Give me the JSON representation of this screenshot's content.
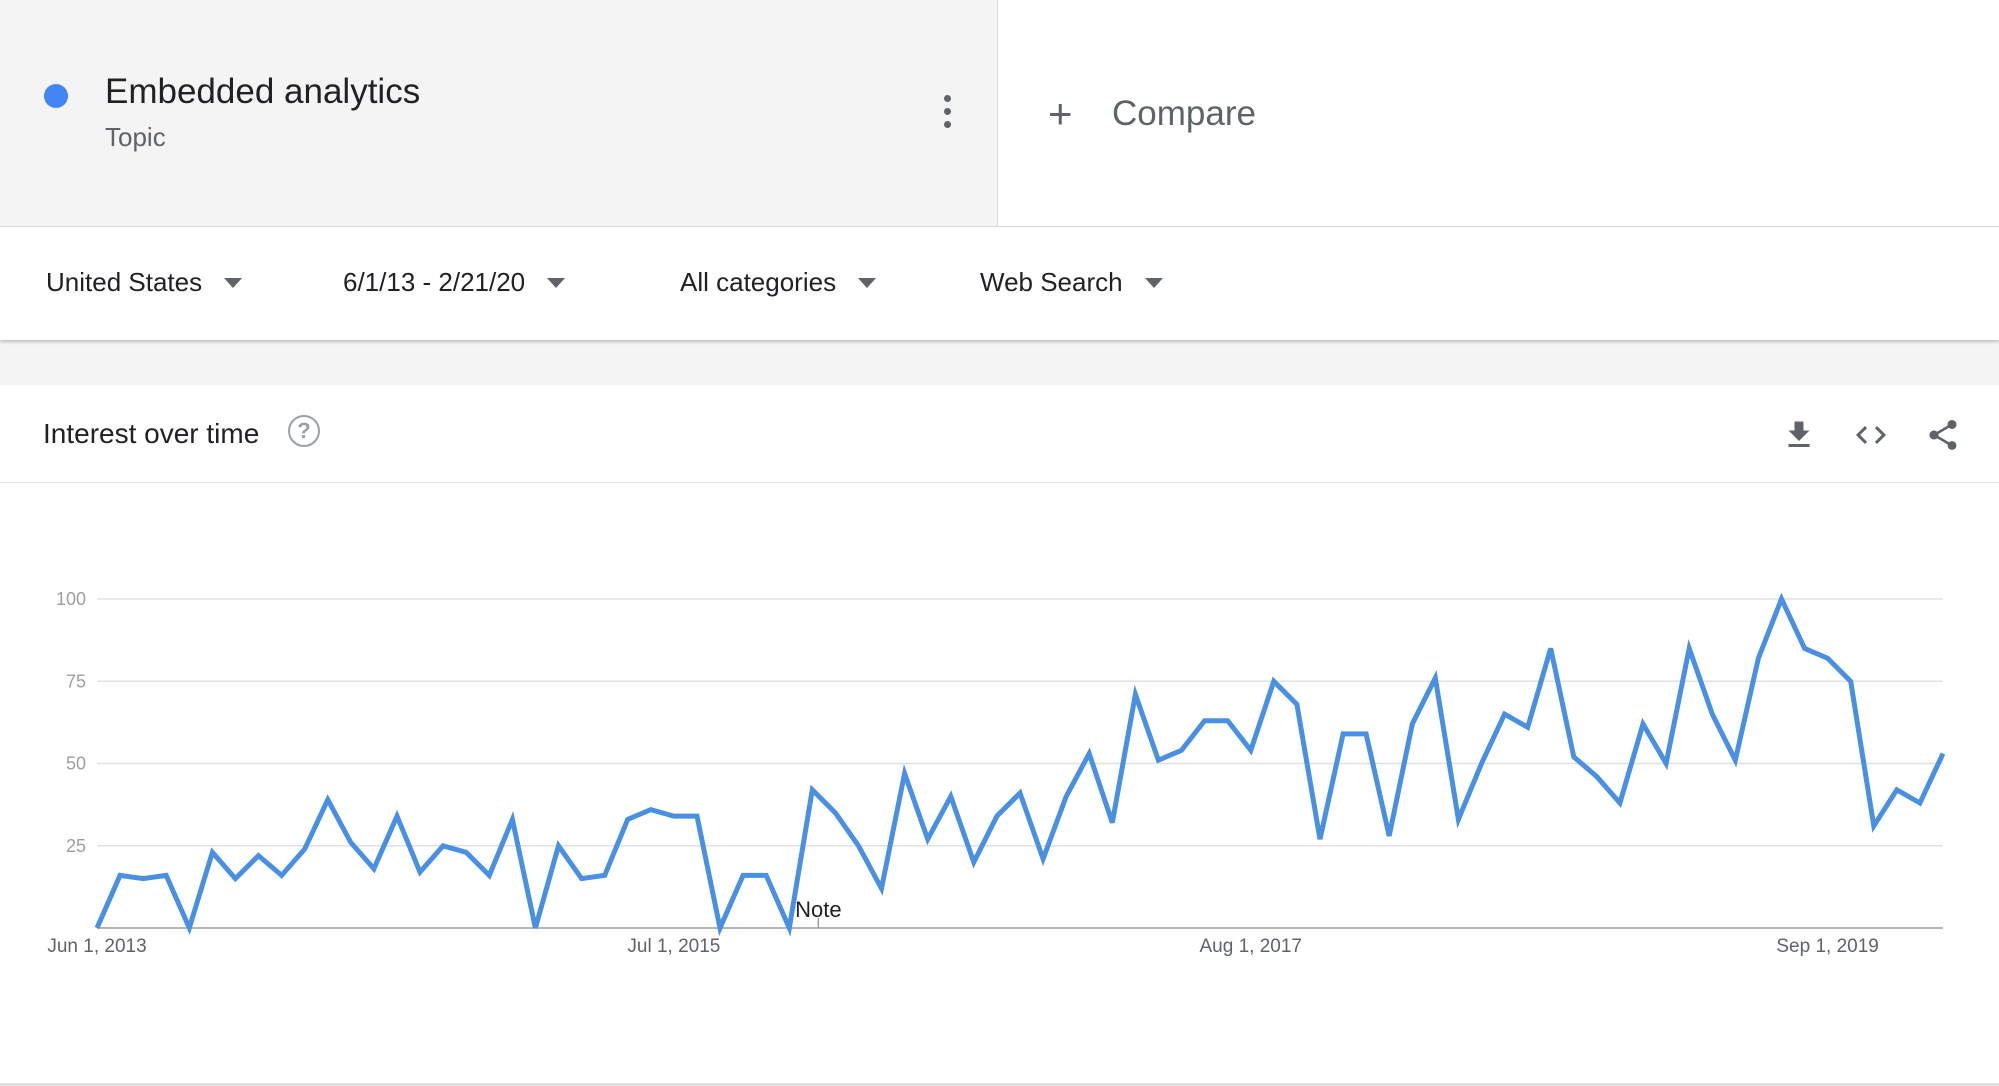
{
  "term": {
    "name": "Embedded analytics",
    "type": "Topic",
    "color": "#4285f4"
  },
  "compare": {
    "label": "Compare",
    "icon": "plus-icon"
  },
  "filters": {
    "region": "United States",
    "date_range": "6/1/13 - 2/21/20",
    "category": "All categories",
    "property": "Web Search"
  },
  "card": {
    "title": "Interest over time",
    "icons": [
      "help-icon",
      "download-icon",
      "embed-icon",
      "share-icon"
    ]
  },
  "chart_data": {
    "type": "line",
    "title": "",
    "xlabel": "",
    "ylabel": "",
    "ylim": [
      0,
      100
    ],
    "yticks": [
      "25",
      "50",
      "75",
      "100"
    ],
    "xticks": [
      {
        "label": "Jun 1, 2013",
        "index": 0
      },
      {
        "label": "Jul 1, 2015",
        "index": 25
      },
      {
        "label": "Aug 1, 2017",
        "index": 50
      },
      {
        "label": "Sep 1, 2019",
        "index": 75
      }
    ],
    "annotation": {
      "label": "Note",
      "index": 31
    },
    "grid": true,
    "legend": "none",
    "line_color": "#4a90e2",
    "series": [
      {
        "values": [
          0,
          16,
          15,
          16,
          0,
          23,
          15,
          22,
          16,
          24,
          39,
          26,
          18,
          34,
          17,
          25,
          23,
          16,
          33,
          0,
          25,
          15,
          16,
          33,
          36,
          34,
          34,
          0,
          16,
          16,
          0,
          42,
          35,
          25,
          12,
          47,
          27,
          40,
          20,
          34,
          41,
          21,
          40,
          53,
          32,
          71,
          51,
          54,
          63,
          63,
          54,
          75,
          68,
          27,
          59,
          59,
          28,
          62,
          76,
          33,
          50,
          65,
          61,
          85,
          52,
          46,
          38,
          62,
          50,
          85,
          65,
          51,
          82,
          100,
          85,
          82,
          75,
          31,
          42,
          38,
          53
        ]
      }
    ]
  }
}
